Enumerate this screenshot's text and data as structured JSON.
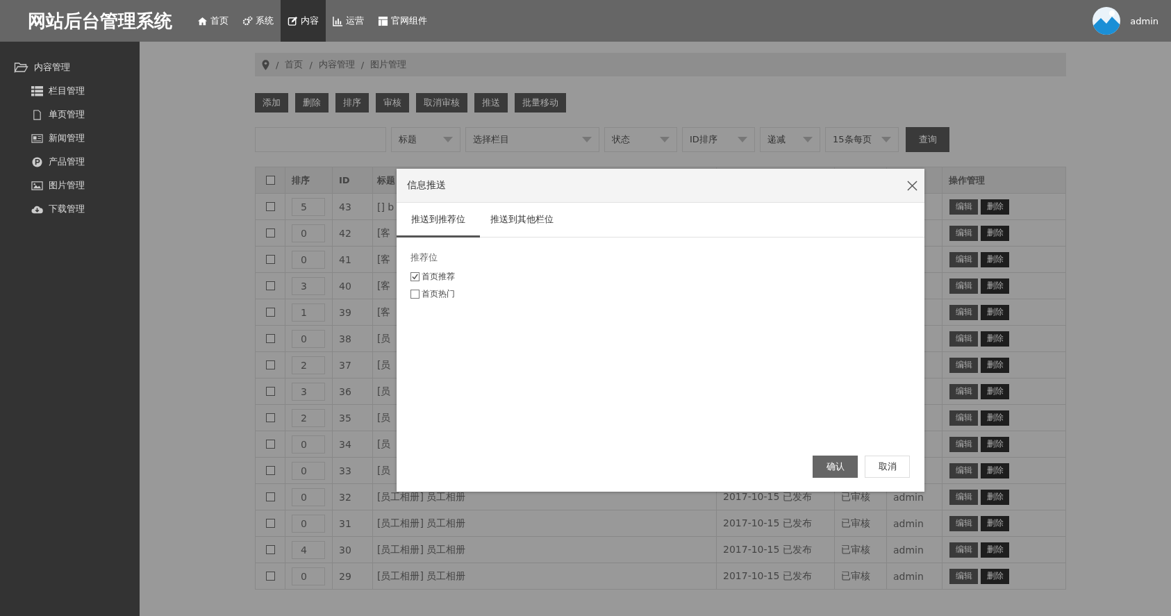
{
  "header": {
    "logo": "网站后台管理系统",
    "nav": [
      {
        "label": "首页",
        "selected": false
      },
      {
        "label": "系统",
        "selected": false
      },
      {
        "label": "内容",
        "selected": true
      },
      {
        "label": "运营",
        "selected": false
      },
      {
        "label": "官网组件",
        "selected": false
      }
    ],
    "user": "admin"
  },
  "sidebar": {
    "group": "内容管理",
    "items": [
      "栏目管理",
      "单页管理",
      "新闻管理",
      "产品管理",
      "图片管理",
      "下载管理"
    ]
  },
  "breadcrumb": [
    {
      "sep": "/",
      "label": "首页"
    },
    {
      "sep": "/",
      "label": "内容管理"
    },
    {
      "sep": "/",
      "label": "图片管理"
    }
  ],
  "toolbar": [
    "添加",
    "删除",
    "排序",
    "审核",
    "取消审核",
    "推送",
    "批量移动"
  ],
  "filters": {
    "selects": [
      "标题",
      "选择栏目",
      "状态",
      "ID排序",
      "递减",
      "15条每页"
    ],
    "query": "查询"
  },
  "table": {
    "select_all": {
      "checked": false
    },
    "columns": [
      "排序",
      "ID",
      "标题",
      "操作管理"
    ],
    "rows": [
      {
        "checked": false,
        "sort": "5",
        "id": "43",
        "title": "[] b",
        "actions": [
          "编辑",
          "删除"
        ]
      },
      {
        "checked": false,
        "sort": "0",
        "id": "42",
        "title": "[客",
        "actions": [
          "编辑",
          "删除"
        ]
      },
      {
        "checked": false,
        "sort": "0",
        "id": "41",
        "title": "[客",
        "actions": [
          "编辑",
          "删除"
        ]
      },
      {
        "checked": false,
        "sort": "3",
        "id": "40",
        "title": "[客",
        "actions": [
          "编辑",
          "删除"
        ]
      },
      {
        "checked": false,
        "sort": "1",
        "id": "39",
        "title": "[客",
        "actions": [
          "编辑",
          "删除"
        ]
      },
      {
        "checked": false,
        "sort": "0",
        "id": "38",
        "title": "[员",
        "actions": [
          "编辑",
          "删除"
        ]
      },
      {
        "checked": false,
        "sort": "2",
        "id": "37",
        "title": "[员",
        "actions": [
          "编辑",
          "删除"
        ]
      },
      {
        "checked": false,
        "sort": "3",
        "id": "36",
        "title": "[员",
        "actions": [
          "编辑",
          "删除"
        ]
      },
      {
        "checked": false,
        "sort": "2",
        "id": "35",
        "title": "[员",
        "actions": [
          "编辑",
          "删除"
        ]
      },
      {
        "checked": false,
        "sort": "0",
        "id": "34",
        "title": "[员",
        "actions": [
          "编辑",
          "删除"
        ]
      },
      {
        "checked": false,
        "sort": "0",
        "id": "33",
        "title": "[员",
        "actions": [
          "编辑",
          "删除"
        ]
      },
      {
        "checked": false,
        "sort": "0",
        "id": "32",
        "title": "[员工相册] 员工相册",
        "date": "2017-10-15 已发布",
        "status": "已审核",
        "author": "admin",
        "actions": [
          "编辑",
          "删除"
        ]
      },
      {
        "checked": false,
        "sort": "0",
        "id": "31",
        "title": "[员工相册] 员工相册",
        "date": "2017-10-15 已发布",
        "status": "已审核",
        "author": "admin",
        "actions": [
          "编辑",
          "删除"
        ]
      },
      {
        "checked": false,
        "sort": "4",
        "id": "30",
        "title": "[员工相册] 员工相册",
        "date": "2017-10-15 已发布",
        "status": "已审核",
        "author": "admin",
        "actions": [
          "编辑",
          "删除"
        ]
      },
      {
        "checked": false,
        "sort": "0",
        "id": "29",
        "title": "[员工相册] 员工相册",
        "date": "2017-10-15 已发布",
        "status": "已审核",
        "author": "admin",
        "actions": [
          "编辑",
          "删除"
        ]
      }
    ]
  },
  "modal": {
    "title": "信息推送",
    "tabs": [
      {
        "label": "推送到推荐位",
        "selected": true
      },
      {
        "label": "推送到其他栏位",
        "selected": false
      }
    ],
    "section": "推荐位",
    "options": [
      {
        "label": "首页推荐",
        "checked": true
      },
      {
        "label": "首页热门",
        "checked": false
      }
    ],
    "confirm": "确认",
    "cancel": "取消"
  }
}
